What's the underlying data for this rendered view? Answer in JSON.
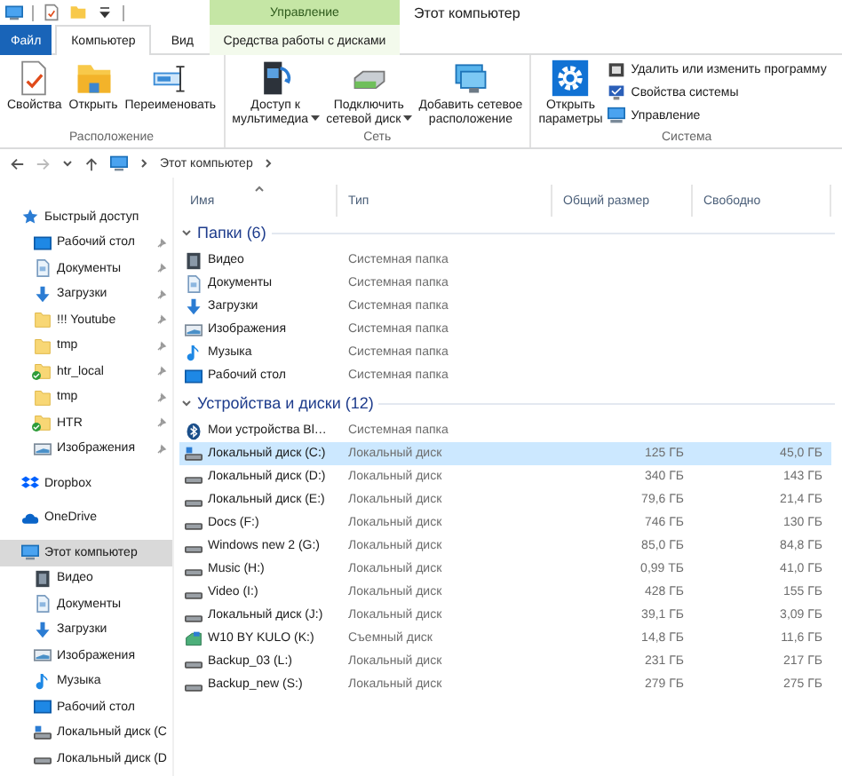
{
  "title_bar": {
    "context_group": "Управление",
    "title": "Этот компьютер"
  },
  "ribbon_tabs": [
    {
      "label": "Файл",
      "kind": "file",
      "selected": false
    },
    {
      "label": "Компьютер",
      "kind": "normal",
      "selected": true
    },
    {
      "label": "Вид",
      "kind": "normal",
      "selected": false
    },
    {
      "label": "Средства работы с дисками",
      "kind": "context",
      "selected": false
    }
  ],
  "ribbon_groups": [
    {
      "label": "Расположение",
      "buttons": [
        {
          "label": "Свойства",
          "kind": "large",
          "has_menu": false
        },
        {
          "label": "Открыть",
          "kind": "large",
          "has_menu": false
        },
        {
          "label": "Переименовать",
          "kind": "large",
          "has_menu": false
        }
      ]
    },
    {
      "label": "Сеть",
      "buttons": [
        {
          "label": "Доступ к\nмультимедиа",
          "kind": "large",
          "has_menu": true
        },
        {
          "label": "Подключить\nсетевой диск",
          "kind": "large",
          "has_menu": true
        },
        {
          "label": "Добавить сетевое\nрасположение",
          "kind": "large",
          "has_menu": false
        }
      ]
    },
    {
      "label": "Система",
      "buttons": [
        {
          "label": "Открыть\nпараметры",
          "kind": "large",
          "has_menu": false
        },
        {
          "label": "Удалить или изменить программу",
          "kind": "small",
          "has_menu": false
        },
        {
          "label": "Свойства системы",
          "kind": "small",
          "has_menu": false
        },
        {
          "label": "Управление",
          "kind": "small",
          "has_menu": false
        }
      ]
    }
  ],
  "address_bar": {
    "path": [
      "Этот компьютер"
    ]
  },
  "navigation": [
    {
      "label": "Быстрый доступ",
      "kind": "quick_access",
      "selected": false,
      "children": [
        {
          "label": "Рабочий стол",
          "kind": "desktop",
          "pinned": true,
          "synced": false,
          "selected": false
        },
        {
          "label": "Документы",
          "kind": "documents",
          "pinned": true,
          "synced": false,
          "selected": false
        },
        {
          "label": "Загрузки",
          "kind": "downloads",
          "pinned": true,
          "synced": false,
          "selected": false
        },
        {
          "label": "!!! Youtube",
          "kind": "folder",
          "pinned": true,
          "synced": false,
          "selected": false
        },
        {
          "label": "tmp",
          "kind": "folder",
          "pinned": true,
          "synced": false,
          "selected": false
        },
        {
          "label": "htr_local",
          "kind": "folder",
          "pinned": true,
          "synced": true,
          "selected": false
        },
        {
          "label": "tmp",
          "kind": "folder",
          "pinned": true,
          "synced": false,
          "selected": false
        },
        {
          "label": "HTR",
          "kind": "folder",
          "pinned": true,
          "synced": true,
          "selected": false
        },
        {
          "label": "Изображения",
          "kind": "pictures",
          "pinned": true,
          "synced": false,
          "selected": false
        }
      ]
    },
    {
      "label": "Dropbox",
      "kind": "dropbox",
      "selected": false
    },
    {
      "label": "OneDrive",
      "kind": "onedrive",
      "selected": false
    },
    {
      "label": "Этот компьютер",
      "kind": "computer",
      "selected": true,
      "children": [
        {
          "label": "Видео",
          "kind": "video",
          "pinned": false,
          "synced": false,
          "selected": false
        },
        {
          "label": "Документы",
          "kind": "documents",
          "pinned": false,
          "synced": false,
          "selected": false
        },
        {
          "label": "Загрузки",
          "kind": "downloads",
          "pinned": false,
          "synced": false,
          "selected": false
        },
        {
          "label": "Изображения",
          "kind": "pictures",
          "pinned": false,
          "synced": false,
          "selected": false
        },
        {
          "label": "Музыка",
          "kind": "music",
          "pinned": false,
          "synced": false,
          "selected": false
        },
        {
          "label": "Рабочий стол",
          "kind": "desktop",
          "pinned": false,
          "synced": false,
          "selected": false
        },
        {
          "label": "Локальный диск (C",
          "kind": "system_drive",
          "pinned": false,
          "synced": false,
          "selected": false
        },
        {
          "label": "Локальный диск (D",
          "kind": "drive",
          "pinned": false,
          "synced": false,
          "selected": false
        }
      ]
    }
  ],
  "columns": [
    {
      "label": "Имя",
      "sorted": true
    },
    {
      "label": "Тип",
      "sorted": false
    },
    {
      "label": "Общий размер",
      "sorted": false
    },
    {
      "label": "Свободно",
      "sorted": false
    }
  ],
  "groups": [
    {
      "title": "Папки (6)",
      "expanded": true,
      "rows": [
        {
          "name": "Видео",
          "kind": "video",
          "type": "Системная папка",
          "selected": false
        },
        {
          "name": "Документы",
          "kind": "documents",
          "type": "Системная папка",
          "selected": false
        },
        {
          "name": "Загрузки",
          "kind": "downloads",
          "type": "Системная папка",
          "selected": false
        },
        {
          "name": "Изображения",
          "kind": "pictures",
          "type": "Системная папка",
          "selected": false
        },
        {
          "name": "Музыка",
          "kind": "music",
          "type": "Системная папка",
          "selected": false
        },
        {
          "name": "Рабочий стол",
          "kind": "desktop",
          "type": "Системная папка",
          "selected": false
        }
      ]
    },
    {
      "title": "Устройства и диски (12)",
      "expanded": true,
      "rows": [
        {
          "name": "Мои устройства Bl…",
          "kind": "bluetooth",
          "type": "Системная папка",
          "selected": false
        },
        {
          "name": "Локальный диск (C:)",
          "kind": "system_drive",
          "type": "Локальный диск",
          "size": "125 ГБ",
          "free": "45,0 ГБ",
          "selected": true
        },
        {
          "name": "Локальный диск (D:)",
          "kind": "drive",
          "type": "Локальный диск",
          "size": "340 ГБ",
          "free": "143 ГБ",
          "selected": false
        },
        {
          "name": "Локальный диск (E:)",
          "kind": "drive",
          "type": "Локальный диск",
          "size": "79,6 ГБ",
          "free": "21,4 ГБ",
          "selected": false
        },
        {
          "name": "Docs (F:)",
          "kind": "drive",
          "type": "Локальный диск",
          "size": "746 ГБ",
          "free": "130 ГБ",
          "selected": false
        },
        {
          "name": "Windows new 2 (G:)",
          "kind": "drive",
          "type": "Локальный диск",
          "size": "85,0 ГБ",
          "free": "84,8 ГБ",
          "selected": false
        },
        {
          "name": "Music (H:)",
          "kind": "drive",
          "type": "Локальный диск",
          "size": "0,99 ТБ",
          "free": "41,0 ГБ",
          "selected": false
        },
        {
          "name": "Video (I:)",
          "kind": "drive",
          "type": "Локальный диск",
          "size": "428 ГБ",
          "free": "155 ГБ",
          "selected": false
        },
        {
          "name": "Локальный диск (J:)",
          "kind": "drive",
          "type": "Локальный диск",
          "size": "39,1 ГБ",
          "free": "3,09 ГБ",
          "selected": false
        },
        {
          "name": "W10 BY KULO (K:)",
          "kind": "usb",
          "type": "Съемный диск",
          "size": "14,8 ГБ",
          "free": "11,6 ГБ",
          "selected": false
        },
        {
          "name": "Backup_03 (L:)",
          "kind": "drive",
          "type": "Локальный диск",
          "size": "231 ГБ",
          "free": "217 ГБ",
          "selected": false
        },
        {
          "name": "Backup_new (S:)",
          "kind": "drive",
          "type": "Локальный диск",
          "size": "279 ГБ",
          "free": "275 ГБ",
          "selected": false
        }
      ]
    }
  ]
}
